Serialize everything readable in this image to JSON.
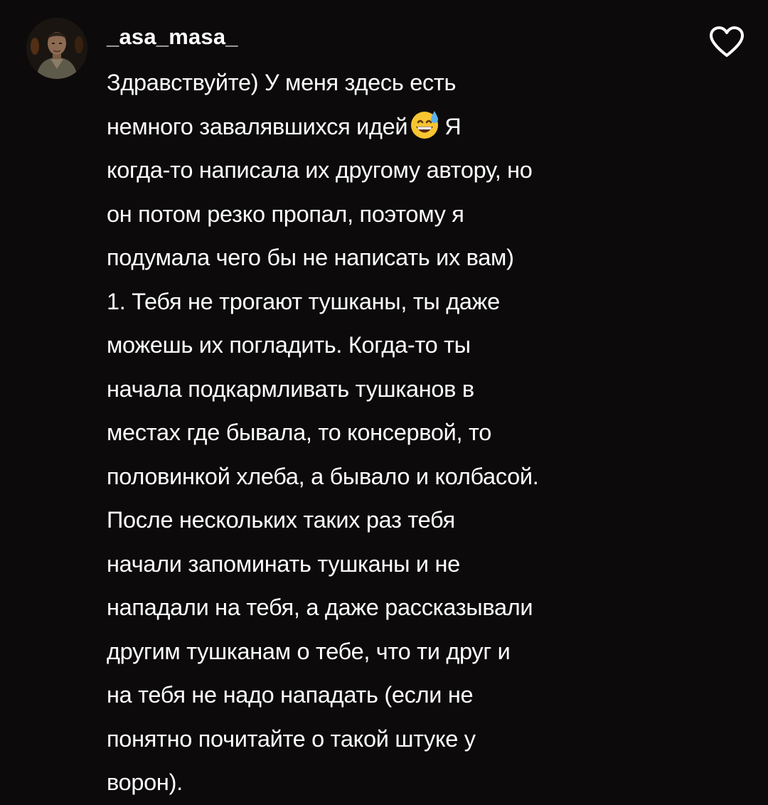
{
  "comment": {
    "username": "_asa_masa_",
    "avatar": "avatar-photo",
    "like_icon": "heart-outline-icon",
    "lines": [
      "Здравствуйте) У меня здесь есть",
      "немного завалявшихся идей",
      "когда-то написала их другому автору, но",
      "он потом резко пропал, поэтому я",
      "подумала чего бы не написать их вам)",
      "1. Тебя не трогают тушканы, ты даже",
      "можешь их погладить. Когда-то ты",
      "начала подкармливать тушканов в",
      "местах где бывала, то консервой, то",
      "половинкой хлеба, а бывало и колбасой.",
      "После нескольких таких раз тебя",
      "начали запоминать тушканы и не",
      "нападали на тебя, а даже рассказывали",
      "другим тушканам о тебе, что ти друг и",
      "на тебя не надо нападать (если не",
      "понятно почитайте о такой штуке у",
      "ворон)."
    ],
    "line2_after_emoji": "Я",
    "emoji": "grinning-face-with-sweat-emoji"
  },
  "colors": {
    "background": "#0c0a0b",
    "text": "#ffffff"
  }
}
